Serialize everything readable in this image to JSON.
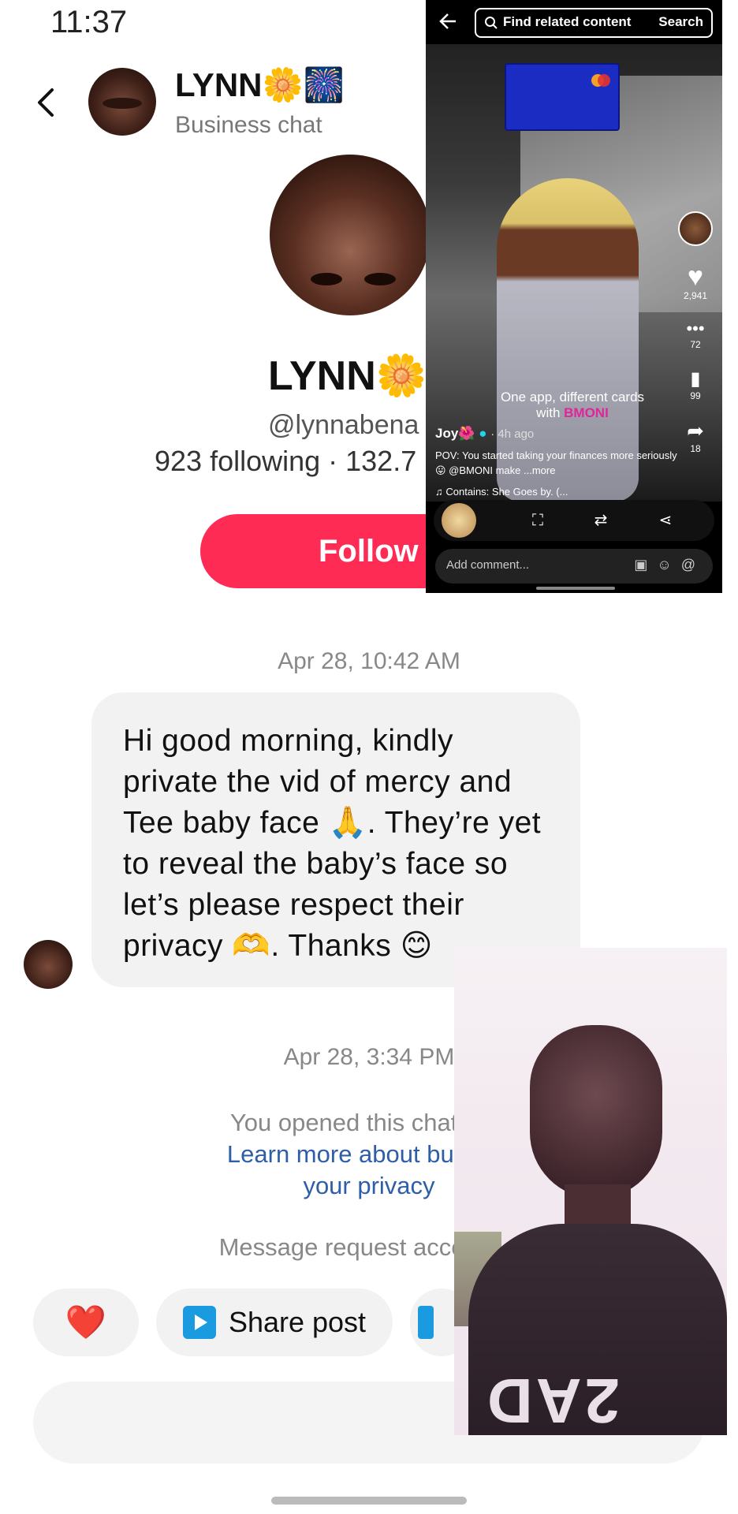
{
  "status_bar": {
    "time": "11:37"
  },
  "header": {
    "name": "LYNN🌼🎆",
    "subtitle": "Business chat"
  },
  "profile": {
    "name": "LYNN🌼",
    "handle": "@lynnabena",
    "stats": "923 following · 132.7",
    "follow_label": "Follow"
  },
  "chat": {
    "timestamp_1": "Apr 28, 10:42 AM",
    "message_text": "Hi good morning, kindly private the vid of mercy and Tee baby face 🙏. They’re yet to reveal the baby’s face so let’s please respect their privacy 🫶. Thanks 😊",
    "timestamp_2": "Apr 28, 3:34 PM",
    "notice_line_1": "You opened this chat with",
    "notice_link_1": "Learn more about busines",
    "notice_link_2": "your privacy",
    "request_accepted": "Message request accepted."
  },
  "quick_actions": {
    "heart": "❤️",
    "share_post": "Share post"
  },
  "overlay_video_top": {
    "search_placeholder": "Find related content",
    "search_button": "Search",
    "like_count": "2,941",
    "comment_count": "72",
    "save_count": "99",
    "share_count": "18",
    "caption_line_1": "One app, different cards",
    "caption_line_2_prefix": "with",
    "caption_brand": "BMONI",
    "author": "Joy🌺",
    "posted_ago": "· 4h ago",
    "description": "POV: You started taking your finances more seriously😛 @BMONI make ...more",
    "music": "♫ Contains: She Goes by. (...",
    "comment_placeholder": "Add comment..."
  },
  "overlay_video_bottom": {
    "shirt_text": "2AD"
  },
  "colors": {
    "follow": "#fe2c55",
    "link": "#2f5ea8",
    "share_icon": "#1a9be0"
  }
}
